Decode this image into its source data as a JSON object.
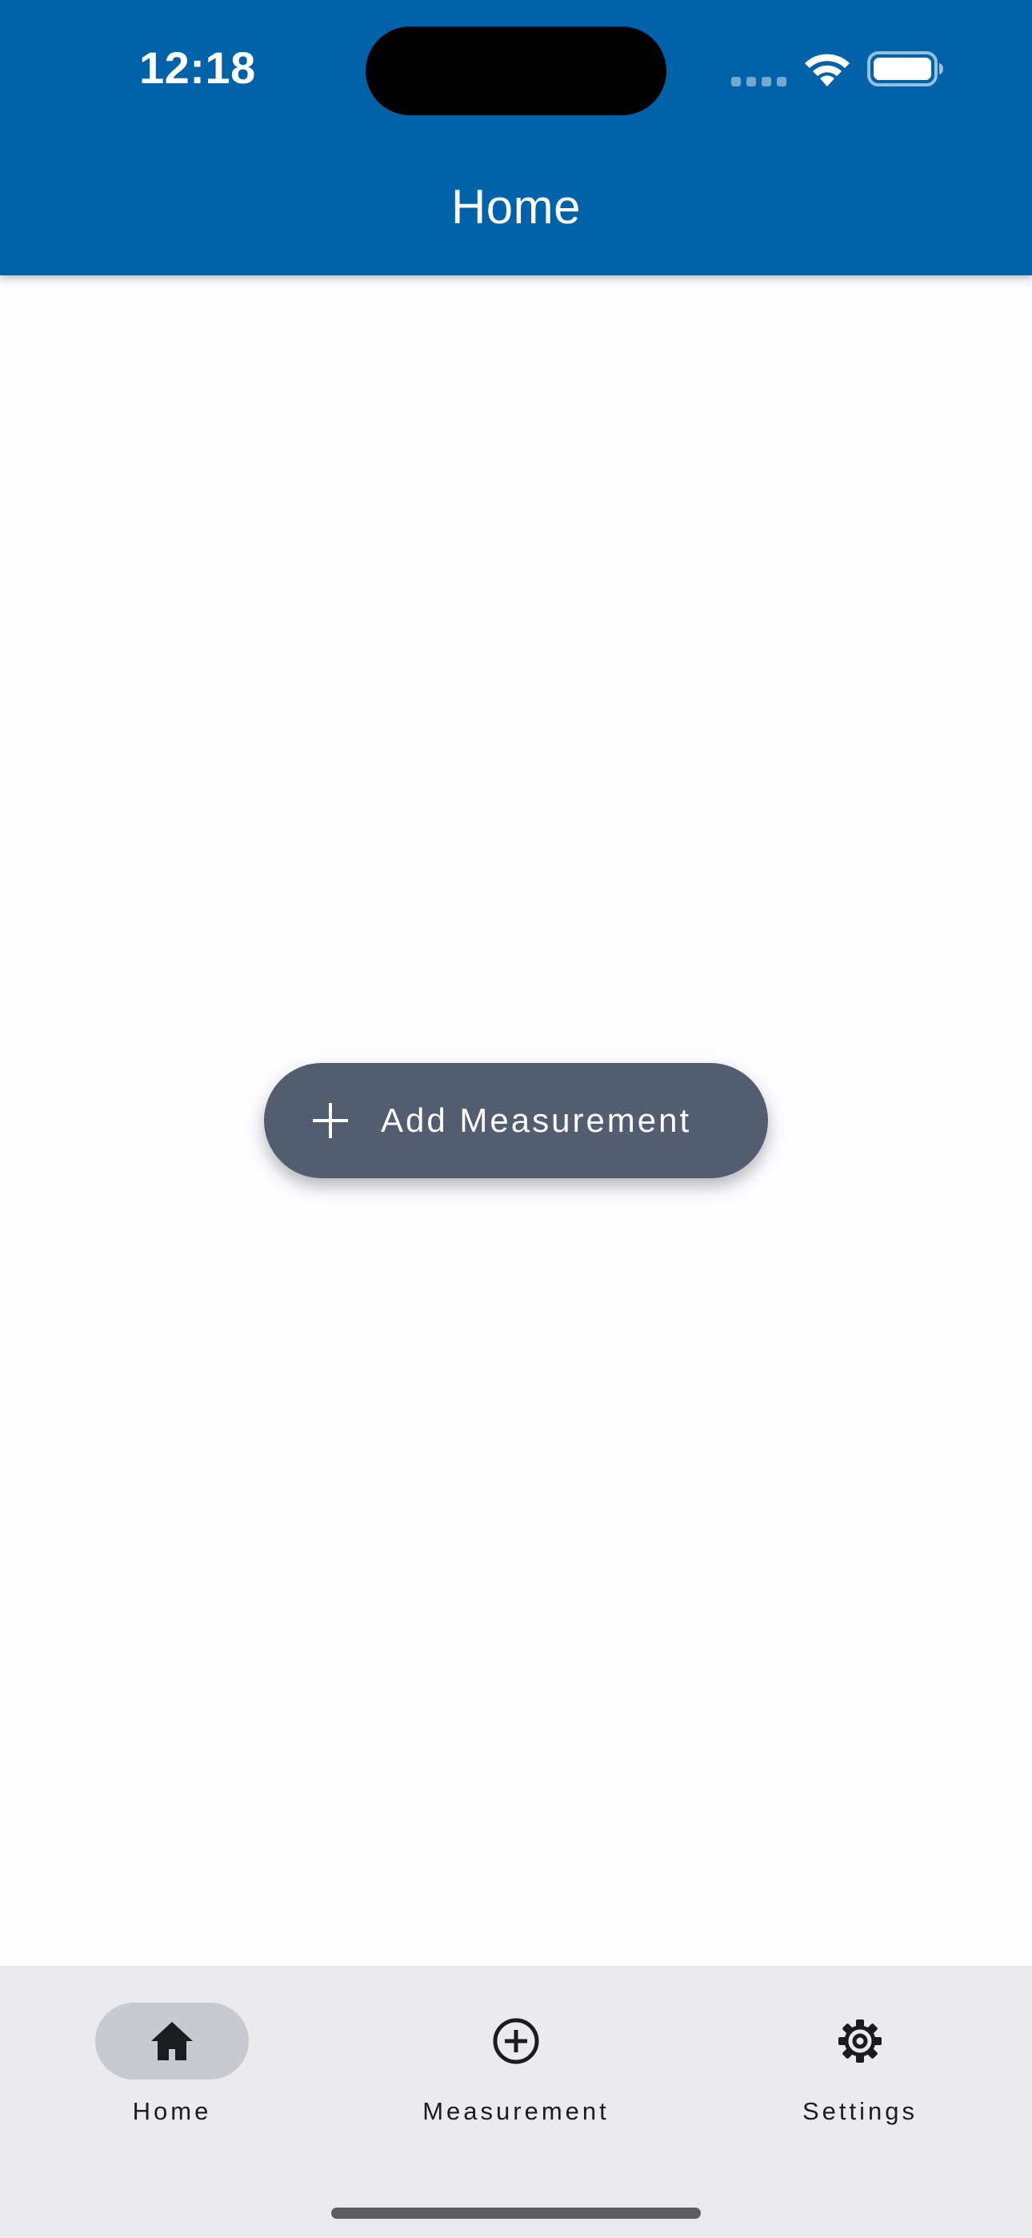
{
  "status_bar": {
    "time": "12:18"
  },
  "header": {
    "title": "Home",
    "background_color": "#0063a9"
  },
  "main": {
    "add_button": {
      "label": "Add Measurement",
      "icon": "plus-icon",
      "background_color": "#535d70"
    }
  },
  "bottom_nav": {
    "items": [
      {
        "label": "Home",
        "icon": "home-icon",
        "active": true
      },
      {
        "label": "Measurement",
        "icon": "add-circle-icon",
        "active": false
      },
      {
        "label": "Settings",
        "icon": "gear-icon",
        "active": false
      }
    ]
  }
}
